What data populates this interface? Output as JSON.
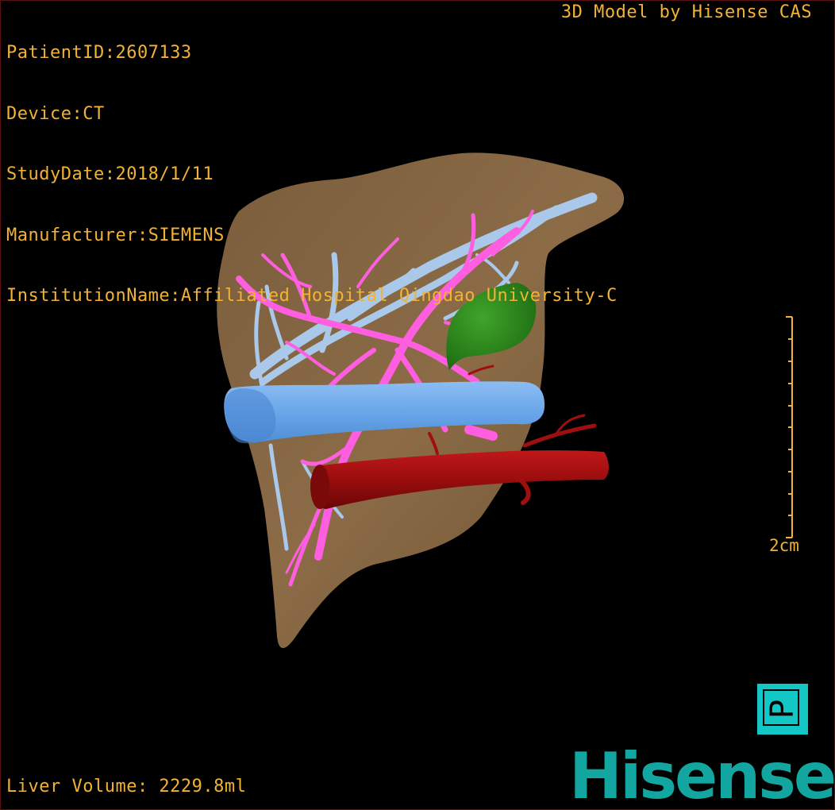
{
  "patient_info": {
    "patient_id": "PatientID:2607133",
    "device": "Device:CT",
    "study_date": "StudyDate:2018/1/11",
    "manufacturer": "Manufacturer:SIEMENS",
    "institution": "InstitutionName:Affiliated Hospital Qingdao University-C"
  },
  "credit": "3D Model by Hisense CAS",
  "liver_volume": "Liver Volume: 2229.8ml",
  "scale_bar": {
    "label": "2cm"
  },
  "orientation_marker": {
    "letter": "P",
    "color": "#14c7c7"
  },
  "brand": {
    "text": "Hisense",
    "color": "#13a5a0"
  },
  "model": {
    "structures": [
      {
        "name": "liver",
        "color": "#8a6a45"
      },
      {
        "name": "portal-vein",
        "color": "#ff5ee0"
      },
      {
        "name": "hepatic-vein",
        "color": "#9fc0e8"
      },
      {
        "name": "inferior-vena-cava",
        "color": "#6fa8ea"
      },
      {
        "name": "aorta",
        "color": "#a00f0f"
      },
      {
        "name": "lesion",
        "color": "#2f8f1f"
      }
    ]
  },
  "accent_text_color": "#f2b233"
}
